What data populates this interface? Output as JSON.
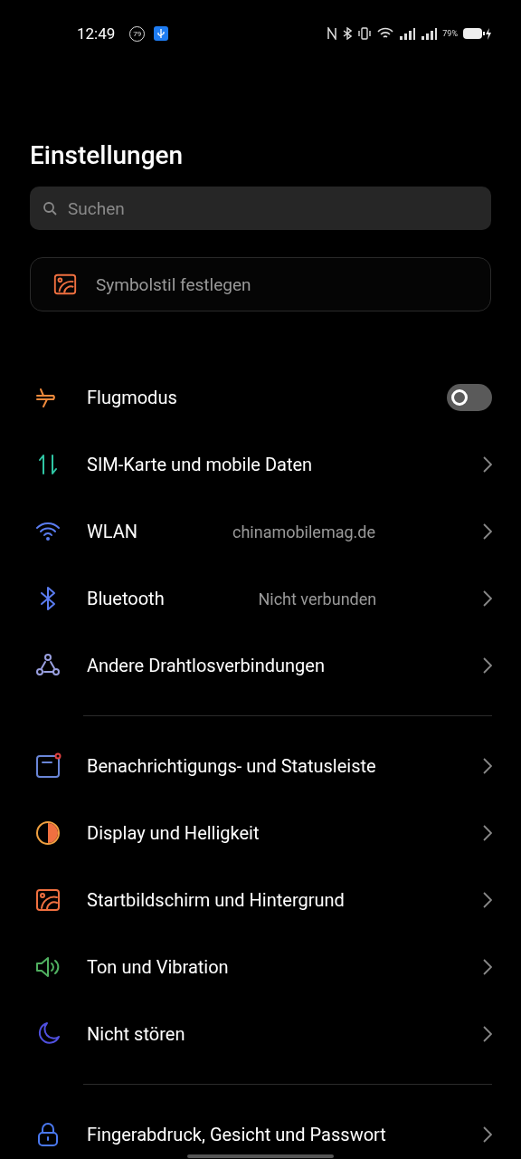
{
  "status_bar": {
    "time": "12:49",
    "badge": "79",
    "battery": "79%"
  },
  "title": "Einstellungen",
  "search": {
    "placeholder": "Suchen"
  },
  "banner": {
    "label": "Symbolstil festlegen"
  },
  "groups": [
    {
      "rows": [
        {
          "kind": "toggle",
          "label": "Flugmodus",
          "on": false
        },
        {
          "kind": "link",
          "label": "SIM-Karte und mobile Daten"
        },
        {
          "kind": "link",
          "label": "WLAN",
          "value": "chinamobilemag.de"
        },
        {
          "kind": "link",
          "label": "Bluetooth",
          "value": "Nicht verbunden"
        },
        {
          "kind": "link",
          "label": "Andere Drahtlosverbindungen"
        }
      ]
    },
    {
      "rows": [
        {
          "kind": "link",
          "label": "Benachrichtigungs- und Statusleiste"
        },
        {
          "kind": "link",
          "label": "Display und Helligkeit"
        },
        {
          "kind": "link",
          "label": "Startbildschirm und Hintergrund"
        },
        {
          "kind": "link",
          "label": "Ton und Vibration"
        },
        {
          "kind": "link",
          "label": "Nicht stören"
        }
      ]
    },
    {
      "rows": [
        {
          "kind": "link",
          "label": "Fingerabdruck, Gesicht und Passwort"
        }
      ]
    }
  ]
}
